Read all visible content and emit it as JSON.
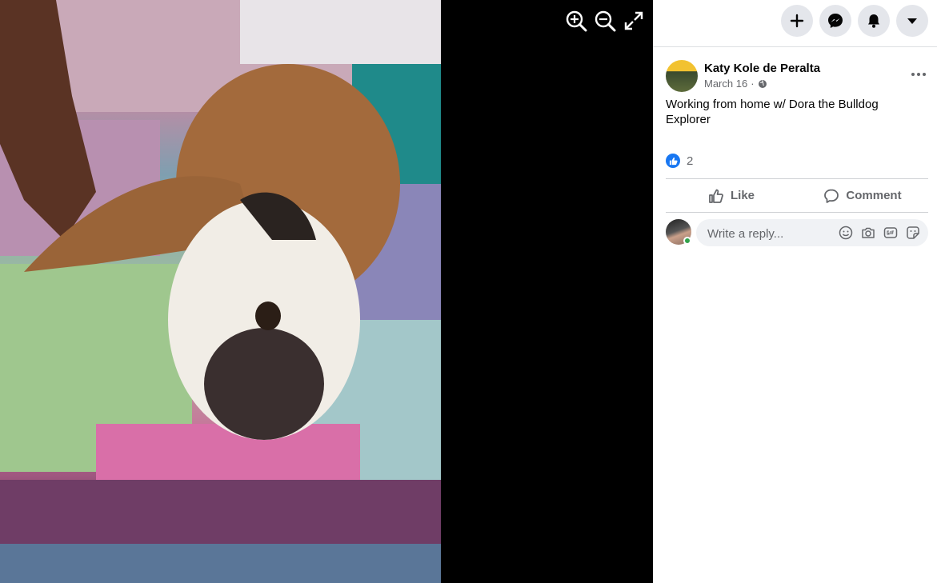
{
  "viewer": {
    "icons": [
      "zoom-in-icon",
      "zoom-out-icon",
      "fullscreen-icon"
    ]
  },
  "topbar": {
    "icons": [
      "plus-icon",
      "messenger-icon",
      "notifications-bell-icon",
      "account-dropdown-icon"
    ]
  },
  "post": {
    "author": "Katy Kole de Peralta",
    "date": "March 16",
    "separator": "·",
    "caption": "Working from home w/ Dora the Bulldog Explorer",
    "reaction_count": "2",
    "actions": {
      "like": "Like",
      "comment": "Comment"
    }
  },
  "reply": {
    "placeholder": "Write a reply..."
  },
  "colors": {
    "accent": "#1877f2",
    "online": "#31a24c",
    "muted_text": "#65676b"
  }
}
